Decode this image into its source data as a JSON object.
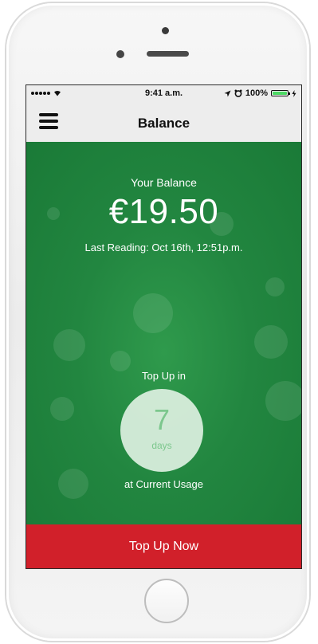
{
  "status_bar": {
    "time": "9:41 a.m.",
    "battery_percent": "100%",
    "battery_level": 1.0,
    "icons": [
      "signal-dots-icon",
      "wifi-icon",
      "location-arrow-icon",
      "alarm-icon",
      "battery-icon",
      "charging-icon"
    ]
  },
  "nav": {
    "title": "Balance",
    "menu_icon": "hamburger-menu-icon"
  },
  "balance": {
    "label": "Your Balance",
    "amount": "€19.50",
    "last_reading": "Last Reading:  Oct 16th, 12:51p.m."
  },
  "topup_forecast": {
    "prefix": "Top Up in",
    "days_value": "7",
    "days_unit": "days",
    "suffix": "at Current Usage"
  },
  "action": {
    "button_label": "Top Up Now"
  },
  "colors": {
    "green_background": "#228640",
    "button_red": "#d1202a",
    "circle_text": "#7cc78d"
  }
}
